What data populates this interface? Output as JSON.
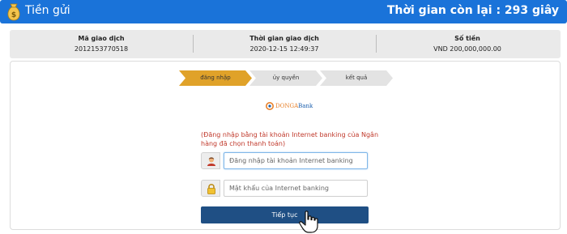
{
  "header": {
    "title": "Tiền gửi",
    "countdown": "Thời gian còn lại : 293 giây",
    "bag_icon": "money-bag-icon"
  },
  "transaction": {
    "id_label": "Mã giao dịch",
    "id_value": "2012153770518",
    "time_label": "Thời gian giao dịch",
    "time_value": "2020-12-15 12:49:37",
    "amount_label": "Số tiền",
    "amount_value": "VND 200,000,000.00"
  },
  "steps": [
    {
      "label": "đăng nhập",
      "active": true
    },
    {
      "label": "ủy quyền",
      "active": false
    },
    {
      "label": "kết quả",
      "active": false
    }
  ],
  "bank": {
    "logo_part1": "DONGA",
    "logo_part2": "Bank"
  },
  "login": {
    "note": "(Đăng nhập bằng tài khoản Internet banking của Ngân hàng đã chọn thanh toán)",
    "username_placeholder": "Đăng nhập tài khoản Internet banking",
    "password_placeholder": "Mật khẩu của Internet banking",
    "continue_label": "Tiếp tục"
  },
  "colors": {
    "header_bg": "#1a73d9",
    "step_active": "#e0a229",
    "step_inactive": "#e3e3e3",
    "button_bg": "#1f4f84",
    "note_text": "#c0392b"
  }
}
